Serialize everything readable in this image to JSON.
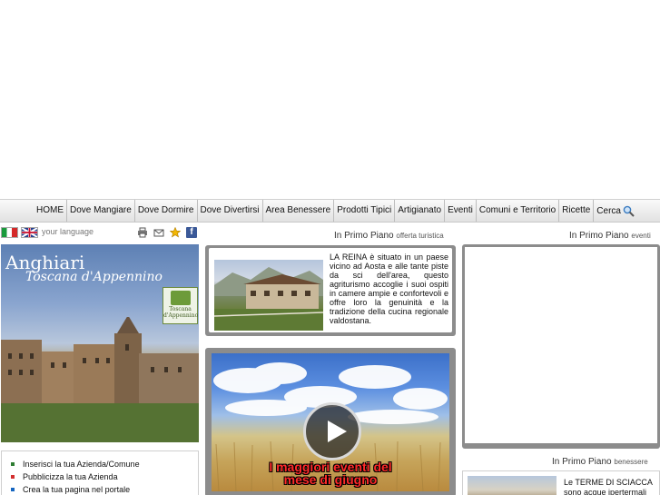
{
  "nav": {
    "items": [
      "HOME",
      "Dove Mangiare",
      "Dove Dormire",
      "Dove Divertirsi",
      "Area Benessere",
      "Prodotti Tipici",
      "Artigianato",
      "Eventi",
      "Comuni e Territorio",
      "Ricette"
    ],
    "search_label": "Cerca",
    "search_icon": "magnifier"
  },
  "language": {
    "label": "your language",
    "flags": [
      "italian-flag",
      "english-flag"
    ],
    "tools": [
      "print-icon",
      "email-icon",
      "favorite-star-icon",
      "facebook-icon"
    ]
  },
  "sections": {
    "offerta": {
      "title": "In Primo Piano",
      "sub": "offerta turistica"
    },
    "eventi": {
      "title": "In Primo Piano",
      "sub": "eventi"
    },
    "benessere": {
      "title": "In Primo Piano",
      "sub": "benessere"
    }
  },
  "banner": {
    "title": "Anghiari",
    "subtitle": "Toscana d'Appennino",
    "logo_text": "Toscana d'Appennino"
  },
  "links": [
    {
      "label": "Inserisci la tua Azienda/Comune",
      "color": "#2e7d32"
    },
    {
      "label": "Pubblicizza la tua Azienda",
      "color": "#d32f2f"
    },
    {
      "label": "Crea la tua pagina nel portale",
      "color": "#1565c0"
    }
  ],
  "offer": {
    "text": "LA REINA è situato in un paese vicino ad Aosta e alle tante piste da sci dell'area, questo agriturismo accoglie i suoi ospiti in camere ampie e confortevoli e offre loro la genuinità e la tradizione della cucina regionale valdostana."
  },
  "video": {
    "title_line1": "I maggiori eventi del",
    "title_line2": "mese di giugno"
  },
  "wellness": {
    "text": "Le TERME DI SCIACCA sono acque ipertermali"
  },
  "colors": {
    "card_border": "#8c8c8c",
    "video_title": "#ff2a2a",
    "facebook": "#3b5998"
  }
}
